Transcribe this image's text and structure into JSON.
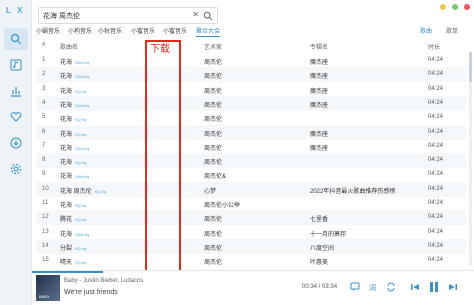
{
  "app": {
    "brand": "L X"
  },
  "sidebar": {
    "items": [
      {
        "name": "search-icon"
      },
      {
        "name": "playlist-icon"
      },
      {
        "name": "charts-icon"
      },
      {
        "name": "favorite-icon"
      },
      {
        "name": "download-icon"
      },
      {
        "name": "settings-icon"
      }
    ]
  },
  "search": {
    "value": "花海 周杰伦",
    "placeholder": "搜索"
  },
  "sources": [
    "小蜗音乐",
    "小枸音乐",
    "小秋音乐",
    "小蜜音乐",
    "小蜜音乐",
    "聚合大会"
  ],
  "subtabs": [
    "歌曲",
    "歌单"
  ],
  "table": {
    "headers": {
      "idx": "#",
      "name": "歌曲名",
      "artist": "艺术家",
      "album": "专辑名",
      "time": "时长"
    },
    "rows": [
      {
        "idx": "1",
        "name": "花海",
        "tag": "24bit hq",
        "artist": "周杰伦",
        "album": "魔杰座",
        "time": "04:24"
      },
      {
        "idx": "2",
        "name": "花海",
        "tag": "24bit hq",
        "artist": "周杰伦",
        "album": "魔杰座",
        "time": "04:24"
      },
      {
        "idx": "3",
        "name": "花海",
        "tag": "SQ hq",
        "artist": "周杰伦",
        "album": "魔杰座",
        "time": "04:24"
      },
      {
        "idx": "4",
        "name": "花海",
        "tag": "24bit hq",
        "artist": "周杰伦",
        "album": "魔杰座",
        "time": "04:24"
      },
      {
        "idx": "5",
        "name": "花海",
        "tag": "SQ hq",
        "artist": "周杰伦",
        "album": "",
        "time": "04:24"
      },
      {
        "idx": "6",
        "name": "花海",
        "tag": "SQ hq",
        "artist": "周杰伦",
        "album": "魔杰座",
        "time": "04:24"
      },
      {
        "idx": "7",
        "name": "花海",
        "tag": "24bit hq",
        "artist": "周杰伦",
        "album": "魔杰座",
        "time": "04:24"
      },
      {
        "idx": "8",
        "name": "花海",
        "tag": "SQ hq",
        "artist": "周杰伦",
        "album": "",
        "time": "04:24"
      },
      {
        "idx": "9",
        "name": "花海",
        "tag": "24bit hq",
        "artist": "周杰伦&",
        "album": "",
        "time": "04:24"
      },
      {
        "idx": "10",
        "name": "花海 周杰伦",
        "tag": "SQ hq",
        "artist": "心梦",
        "album": "2022年抖音最火歌曲推荐伤感榜",
        "time": "04:24"
      },
      {
        "idx": "11",
        "name": "花海",
        "tag": "SQ hq",
        "artist": "周杰伦小公举",
        "album": "",
        "time": "04:24"
      },
      {
        "idx": "12",
        "name": "腾花",
        "tag": "SQ hq",
        "artist": "周杰伦",
        "album": "七里香",
        "time": "04:24"
      },
      {
        "idx": "13",
        "name": "花海",
        "tag": "24bit hq",
        "artist": "周杰伦",
        "album": "十一月的萧邦",
        "time": "04:24"
      },
      {
        "idx": "14",
        "name": "分裂",
        "tag": "SQ hq",
        "artist": "周杰伦",
        "album": "八度空间",
        "time": "04:24"
      },
      {
        "idx": "15",
        "name": "晴天",
        "tag": "SQ hq",
        "artist": "周杰伦",
        "album": "叶惠美",
        "time": "04:24"
      }
    ]
  },
  "annotation": {
    "label": "下载"
  },
  "player": {
    "title": "Baby - Justin Bieber, Ludacris",
    "lyric": "We're just friends",
    "time": "00:34 / 03:34",
    "progress": 0.16,
    "cover_text": "BABY"
  }
}
